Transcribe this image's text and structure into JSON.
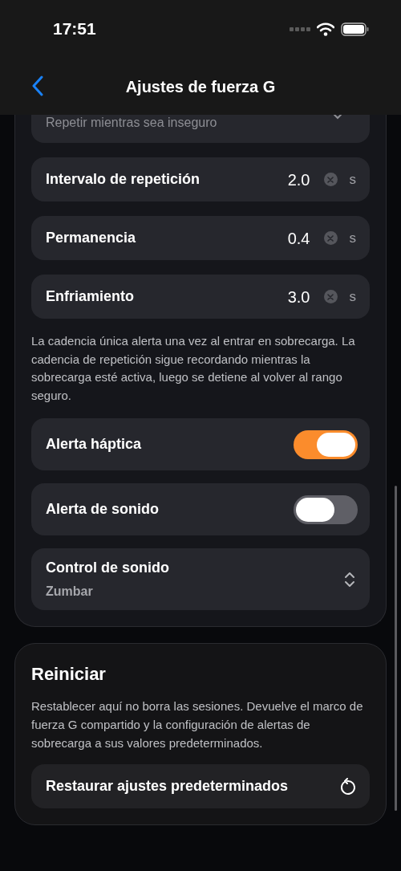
{
  "status_bar": {
    "time": "17:51"
  },
  "nav": {
    "title": "Ajustes de fuerza G"
  },
  "alerts": {
    "cadence_value": "Repetir mientras sea inseguro",
    "number_fields": [
      {
        "label": "Intervalo de repetición",
        "value": "2.0",
        "unit": "s"
      },
      {
        "label": "Permanencia",
        "value": "0.4",
        "unit": "s"
      },
      {
        "label": "Enfriamiento",
        "value": "3.0",
        "unit": "s"
      }
    ],
    "note": "La cadencia única alerta una vez al entrar en sobrecarga. La cadencia de repetición sigue recordando mientras la sobrecarga esté activa, luego se detiene al volver al rango seguro.",
    "toggles": [
      {
        "label": "Alerta háptica",
        "on": true
      },
      {
        "label": "Alerta de sonido",
        "on": false
      }
    ],
    "sound_picker": {
      "label": "Control de sonido",
      "value": "Zumbar"
    }
  },
  "reset": {
    "title": "Reiniciar",
    "description": "Restablecer aquí no borra las sesiones. Devuelve el marco de fuerza G compartido y la configuración de alertas de sobrecarga a sus valores predeterminados.",
    "button": "Restaurar ajustes predeterminados"
  }
}
